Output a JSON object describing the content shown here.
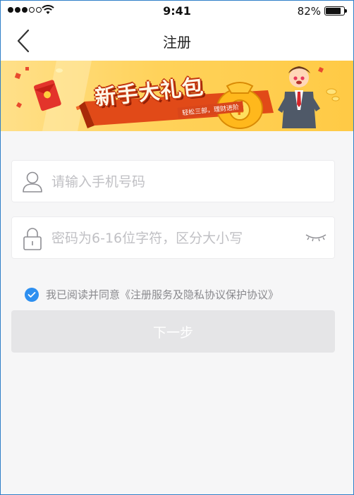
{
  "status_bar": {
    "time": "9:41",
    "battery_percent": "82%",
    "battery_level": 0.82
  },
  "nav": {
    "title": "注册"
  },
  "banner": {
    "headline": "新手大礼包",
    "subline": "轻松三部，理财进阶"
  },
  "form": {
    "phone": {
      "placeholder": "请输入手机号码",
      "value": ""
    },
    "password": {
      "placeholder": "密码为6-16位字符，区分大小写",
      "value": ""
    },
    "agreement": {
      "checked": true,
      "prefix": "我已阅读并同意",
      "link": "《注册服务及隐私协议保护协议》"
    },
    "next_label": "下一步"
  },
  "colors": {
    "accent": "#2d8ff0",
    "disabled_button": "#e5e5e7",
    "placeholder": "#c0c0c4"
  },
  "icons": [
    "back-arrow-icon",
    "user-icon",
    "lock-icon",
    "eye-closed-icon",
    "check-icon",
    "wifi-icon",
    "battery-icon"
  ]
}
